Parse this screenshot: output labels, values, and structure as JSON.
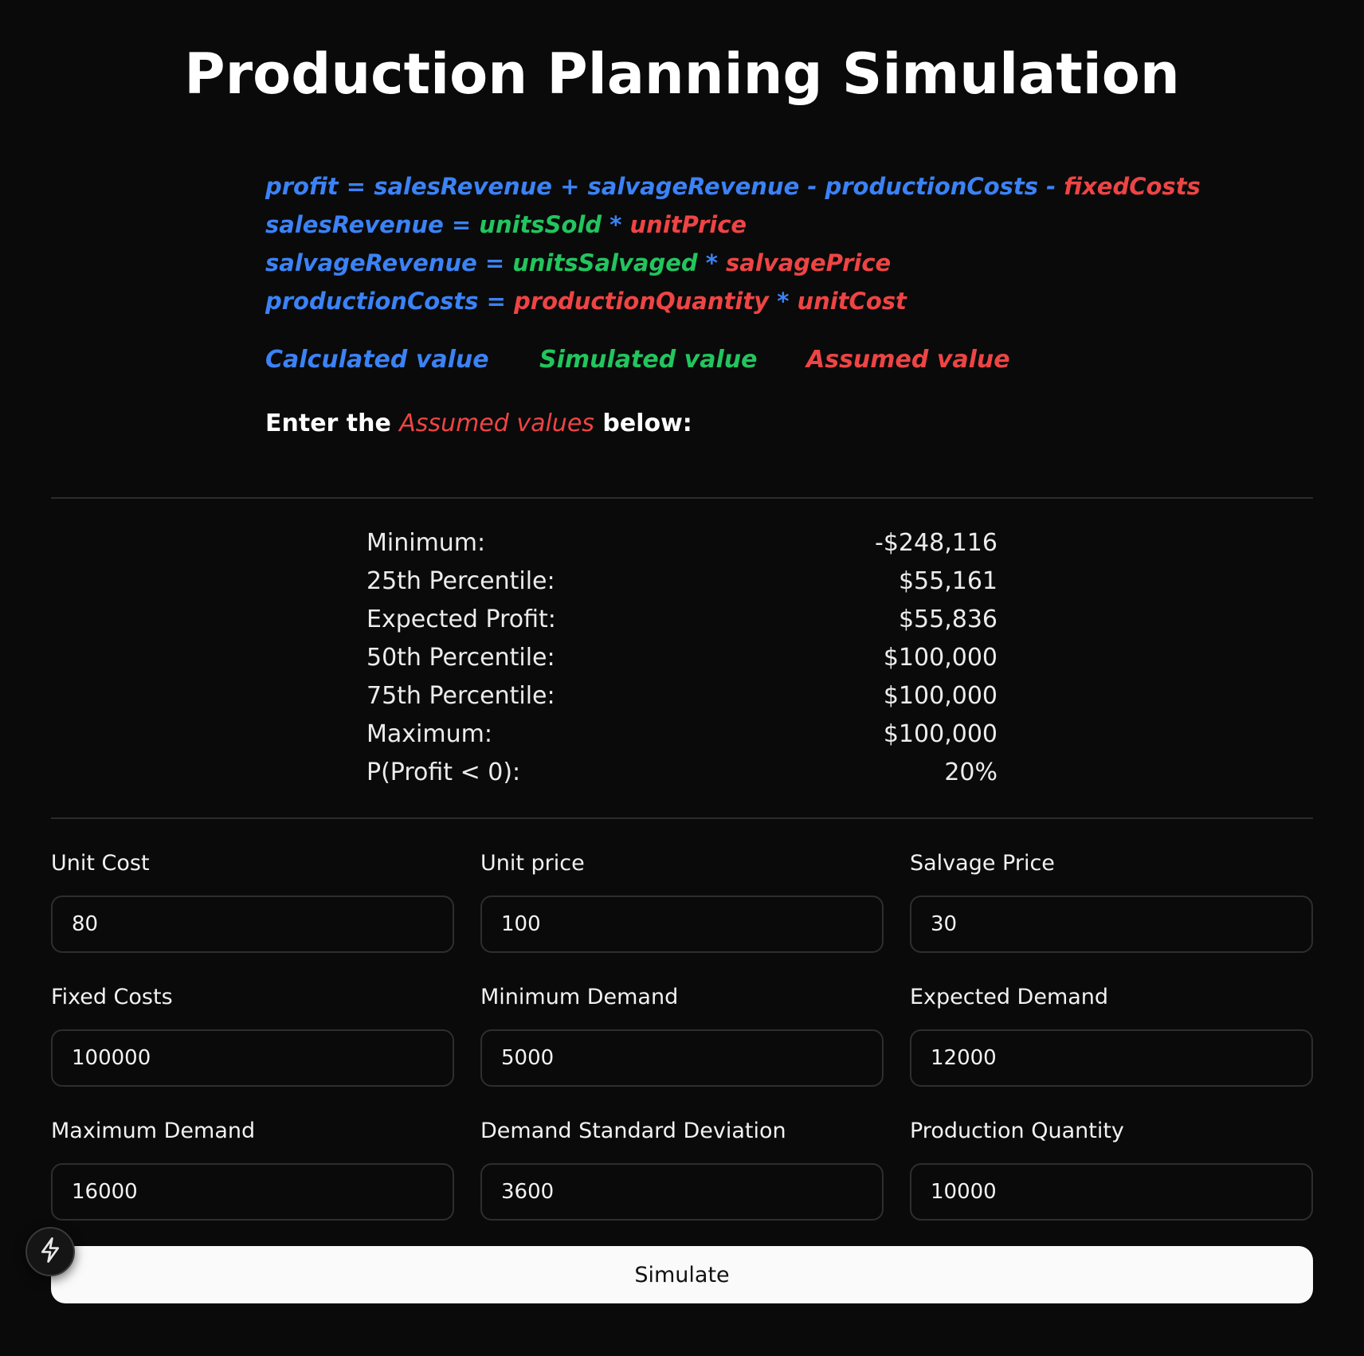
{
  "title": "Production Planning Simulation",
  "formulas": {
    "line1": {
      "profit": "profit",
      "eq": " = ",
      "salesRevenue": "salesRevenue",
      "plus": " + ",
      "salvageRevenue": "salvageRevenue",
      "minus1": " - ",
      "productionCosts": "productionCosts",
      "minus2": " - ",
      "fixedCosts": "fixedCosts"
    },
    "line2": {
      "salesRevenue": "salesRevenue",
      "eq": " = ",
      "unitsSold": "unitsSold",
      "times": " * ",
      "unitPrice": "unitPrice"
    },
    "line3": {
      "salvageRevenue": "salvageRevenue",
      "eq": " = ",
      "unitsSalvaged": "unitsSalvaged",
      "times": " * ",
      "salvagePrice": "salvagePrice"
    },
    "line4": {
      "productionCosts": "productionCosts",
      "eq": " = ",
      "productionQuantity": "productionQuantity",
      "times": " * ",
      "unitCost": "unitCost"
    }
  },
  "legend": {
    "calculated": "Calculated value",
    "simulated": "Simulated value",
    "assumed": "Assumed value"
  },
  "prompt": {
    "before": "Enter the ",
    "highlight": "Assumed values",
    "after": " below:"
  },
  "stats": [
    {
      "label": "Minimum:",
      "value": "-$248,116"
    },
    {
      "label": "25th Percentile:",
      "value": "$55,161"
    },
    {
      "label": "Expected Profit:",
      "value": "$55,836"
    },
    {
      "label": "50th Percentile:",
      "value": "$100,000"
    },
    {
      "label": "75th Percentile:",
      "value": "$100,000"
    },
    {
      "label": "Maximum:",
      "value": "$100,000"
    },
    {
      "label": "P(Profit < 0):",
      "value": "20%"
    }
  ],
  "fields": [
    {
      "label": "Unit Cost",
      "value": "80"
    },
    {
      "label": "Unit price",
      "value": "100"
    },
    {
      "label": "Salvage Price",
      "value": "30"
    },
    {
      "label": "Fixed Costs",
      "value": "100000"
    },
    {
      "label": "Minimum Demand",
      "value": "5000"
    },
    {
      "label": "Expected Demand",
      "value": "12000"
    },
    {
      "label": "Maximum Demand",
      "value": "16000"
    },
    {
      "label": "Demand Standard Deviation",
      "value": "3600"
    },
    {
      "label": "Production Quantity",
      "value": "10000"
    }
  ],
  "simulate_label": "Simulate",
  "fab_icon": "lightning-bolt-icon",
  "colors": {
    "calculated": "#3b82f6",
    "simulated": "#22c55e",
    "assumed": "#ef4444",
    "background": "#0a0a0a"
  }
}
